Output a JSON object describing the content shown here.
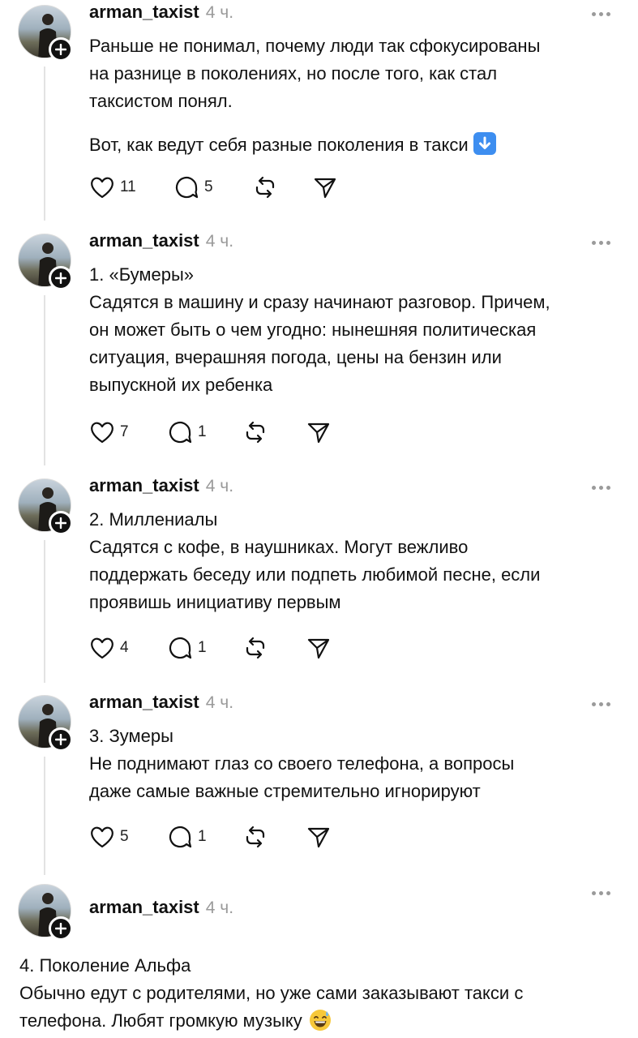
{
  "posts": [
    {
      "username": "arman_taxist",
      "time": "4 ч.",
      "lines": [
        "Раньше не понимал, почему люди так сфокусированы",
        "на разнице в поколениях, но после того, как стал",
        "таксистом понял."
      ],
      "lines2": [
        "Вот, как ведут себя разные поколения в такси"
      ],
      "likes": "11",
      "replies": "5"
    },
    {
      "username": "arman_taxist",
      "time": "4 ч.",
      "lines": [
        "1. «Бумеры»",
        "Садятся в машину и сразу начинают разговор. Причем,",
        "он может быть о чем угодно: нынешняя политическая",
        "ситуация, вчерашняя погода, цены на бензин или",
        "выпускной их ребенка"
      ],
      "likes": "7",
      "replies": "1"
    },
    {
      "username": "arman_taxist",
      "time": "4 ч.",
      "lines": [
        "2. Миллениалы",
        "Садятся с кофе, в наушниках. Могут вежливо",
        "поддержать беседу или подпеть любимой песне, если",
        "проявишь инициативу первым"
      ],
      "likes": "4",
      "replies": "1"
    },
    {
      "username": "arman_taxist",
      "time": "4 ч.",
      "lines": [
        "3. Зумеры",
        "Не поднимают глаз со своего телефона, а вопросы",
        "даже самые важные стремительно игнорируют"
      ],
      "likes": "5",
      "replies": "1"
    },
    {
      "username": "arman_taxist",
      "time": "4 ч.",
      "lines": [
        "4. Поколение Альфа",
        "Обычно едут с родителями, но уже сами заказывают такси с",
        "телефона. Любят громкую музыку"
      ]
    }
  ],
  "icons": {
    "like": "heart-icon",
    "reply": "comment-icon",
    "repost": "repost-icon",
    "share": "send-icon",
    "more": "more-icon",
    "follow": "plus-icon"
  },
  "colors": {
    "text": "#111111",
    "muted": "#9a9a9a",
    "thread_line": "#e3e3e3",
    "emoji_blue": "#3d8ef0"
  }
}
